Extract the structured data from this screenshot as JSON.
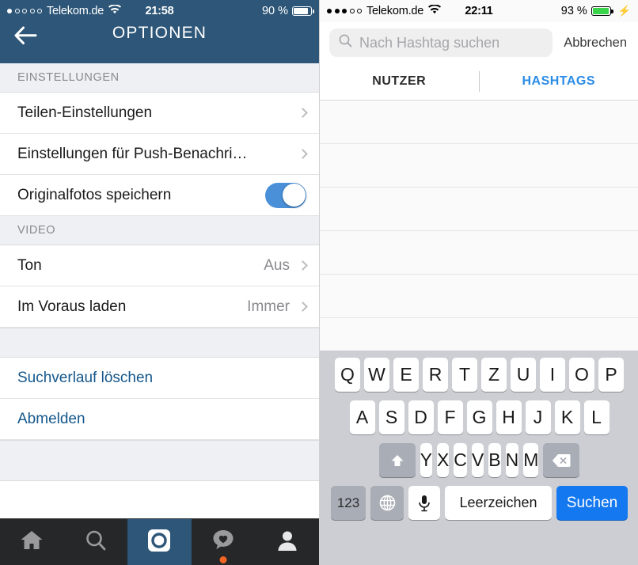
{
  "left_phone": {
    "status_bar": {
      "signal_dots_filled": 1,
      "signal_dots_total": 5,
      "carrier": "Telekom.de",
      "wifi_icon": "wifi-icon",
      "time": "21:58",
      "battery_percent": "90 %",
      "battery_icon": "battery-icon",
      "charging": false
    },
    "navbar": {
      "back_icon": "back-arrow-icon",
      "title": "OPTIONEN"
    },
    "sections": [
      {
        "header": "EINSTELLUNGEN",
        "rows": [
          {
            "label": "Teilen-Einstellungen",
            "value": "",
            "accessory": "chevron"
          },
          {
            "label": "Einstellungen für Push-Benachri…",
            "value": "",
            "accessory": "chevron"
          },
          {
            "label": "Originalfotos speichern",
            "value": "",
            "accessory": "toggle",
            "toggle_on": true
          }
        ]
      },
      {
        "header": "VIDEO",
        "rows": [
          {
            "label": "Ton",
            "value": "Aus",
            "accessory": "chevron"
          },
          {
            "label": "Im Voraus laden",
            "value": "Immer",
            "accessory": "chevron"
          }
        ]
      },
      {
        "header": "",
        "rows": [
          {
            "label": "Suchverlauf löschen",
            "value": "",
            "accessory": "none",
            "style": "link"
          },
          {
            "label": "Abmelden",
            "value": "",
            "accessory": "none",
            "style": "link"
          }
        ]
      }
    ],
    "tabbar": {
      "items": [
        {
          "name": "home-icon",
          "active": false,
          "badge": false
        },
        {
          "name": "search-icon",
          "active": false,
          "badge": false
        },
        {
          "name": "camera-icon",
          "active": true,
          "badge": false
        },
        {
          "name": "activity-heart-icon",
          "active": false,
          "badge": true
        },
        {
          "name": "profile-icon",
          "active": false,
          "badge": false
        }
      ]
    },
    "colors": {
      "navbar": "#2d5678",
      "link": "#14578c",
      "toggle_on": "#4a90d9",
      "tabbar": "#262729",
      "badge": "#f26522"
    }
  },
  "right_phone": {
    "status_bar": {
      "signal_dots_filled": 3,
      "signal_dots_total": 5,
      "carrier": "Telekom.de",
      "wifi_icon": "wifi-icon",
      "time": "22:11",
      "battery_percent": "93 %",
      "battery_icon": "battery-icon",
      "charging": true,
      "charging_icon": "lightning-bolt-icon"
    },
    "search": {
      "icon": "search-icon",
      "placeholder": "Nach Hashtag suchen",
      "value": "",
      "cancel_label": "Abbrechen"
    },
    "tabs": [
      {
        "label": "NUTZER",
        "active": false
      },
      {
        "label": "HASHTAGS",
        "active": true
      }
    ],
    "results": {
      "rows": 6,
      "empty": true
    },
    "keyboard": {
      "row1": [
        "Q",
        "W",
        "E",
        "R",
        "T",
        "Z",
        "U",
        "I",
        "O",
        "P"
      ],
      "row2": [
        "A",
        "S",
        "D",
        "F",
        "G",
        "H",
        "J",
        "K",
        "L"
      ],
      "row3": [
        "Y",
        "X",
        "C",
        "V",
        "B",
        "N",
        "M"
      ],
      "shift_icon": "shift-up-arrow-icon",
      "backspace_icon": "backspace-icon",
      "numbers_label": "123",
      "globe_icon": "globe-icon",
      "mic_icon": "microphone-icon",
      "space_label": "Leerzeichen",
      "search_label": "Suchen"
    },
    "colors": {
      "accent": "#2b8ce6",
      "search_key": "#1478f0",
      "keyboard_bg": "#ccced3",
      "key_bg": "#ffffff",
      "fn_key_bg": "#a9adb5"
    }
  }
}
